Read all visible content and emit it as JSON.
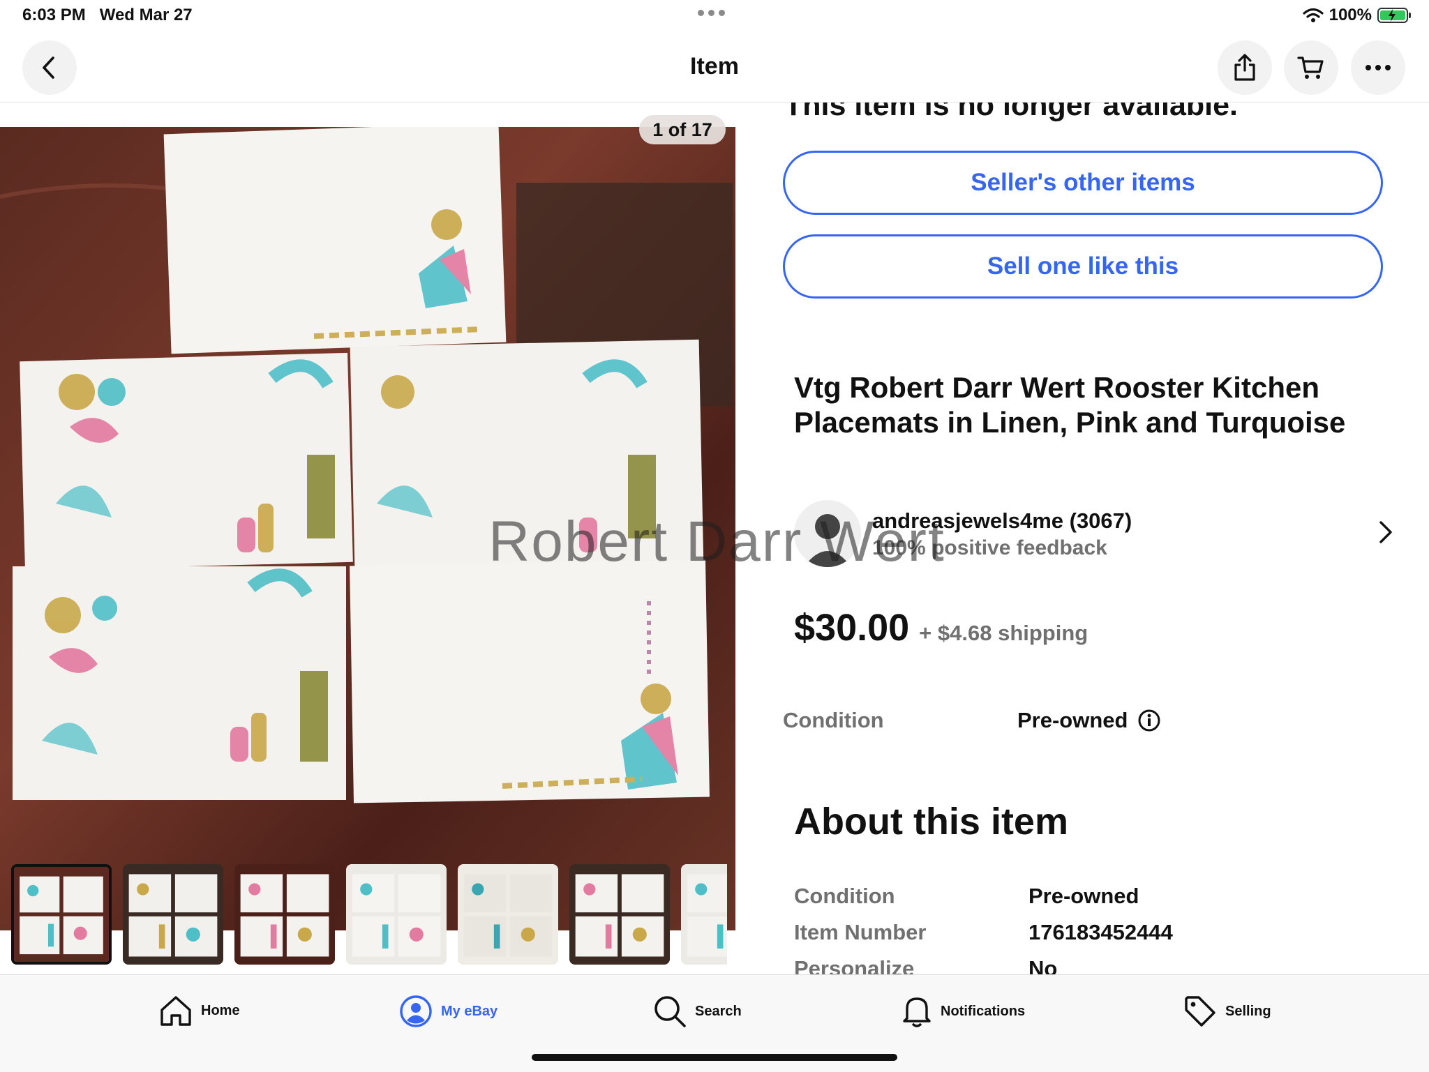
{
  "status_bar": {
    "time": "6:03 PM",
    "date": "Wed Mar 27",
    "battery": "100%",
    "battery_level": 1.0
  },
  "navbar": {
    "title": "Item",
    "back_icon": "chevron-left-icon",
    "share_icon": "share-icon",
    "cart_icon": "cart-icon",
    "more_icon": "more-icon"
  },
  "gallery": {
    "counter": "1 of 17",
    "thumbnail_count": 7,
    "selected_thumbnail": 1
  },
  "panel": {
    "unavailable_text": "This item is no longer available.",
    "sellers_other_items": "Seller's other items",
    "sell_one_like_this": "Sell one like this",
    "title": "Vtg Robert Darr Wert Rooster Kitchen Placemats in Linen, Pink and Turquoise",
    "seller_name": "andreasjewels4me (3067)",
    "seller_feedback": "100% positive feedback",
    "watermark": "Robert Darr Wert",
    "price": "$30.00",
    "shipping": "+ $4.68 shipping",
    "condition_label": "Condition",
    "condition_value": "Pre-owned",
    "about_heading": "About this item",
    "specs": [
      {
        "label": "Condition",
        "value": "Pre-owned"
      },
      {
        "label": "Item Number",
        "value": "176183452444"
      },
      {
        "label": "Personalize",
        "value": "No"
      }
    ]
  },
  "tabbar": {
    "items": [
      {
        "label": "Home",
        "icon": "home-icon"
      },
      {
        "label": "My eBay",
        "icon": "user-icon"
      },
      {
        "label": "Search",
        "icon": "search-icon"
      },
      {
        "label": "Notifications",
        "icon": "bell-icon"
      },
      {
        "label": "Selling",
        "icon": "tag-icon"
      }
    ],
    "active": "My eBay",
    "accent": "#3665f3"
  }
}
